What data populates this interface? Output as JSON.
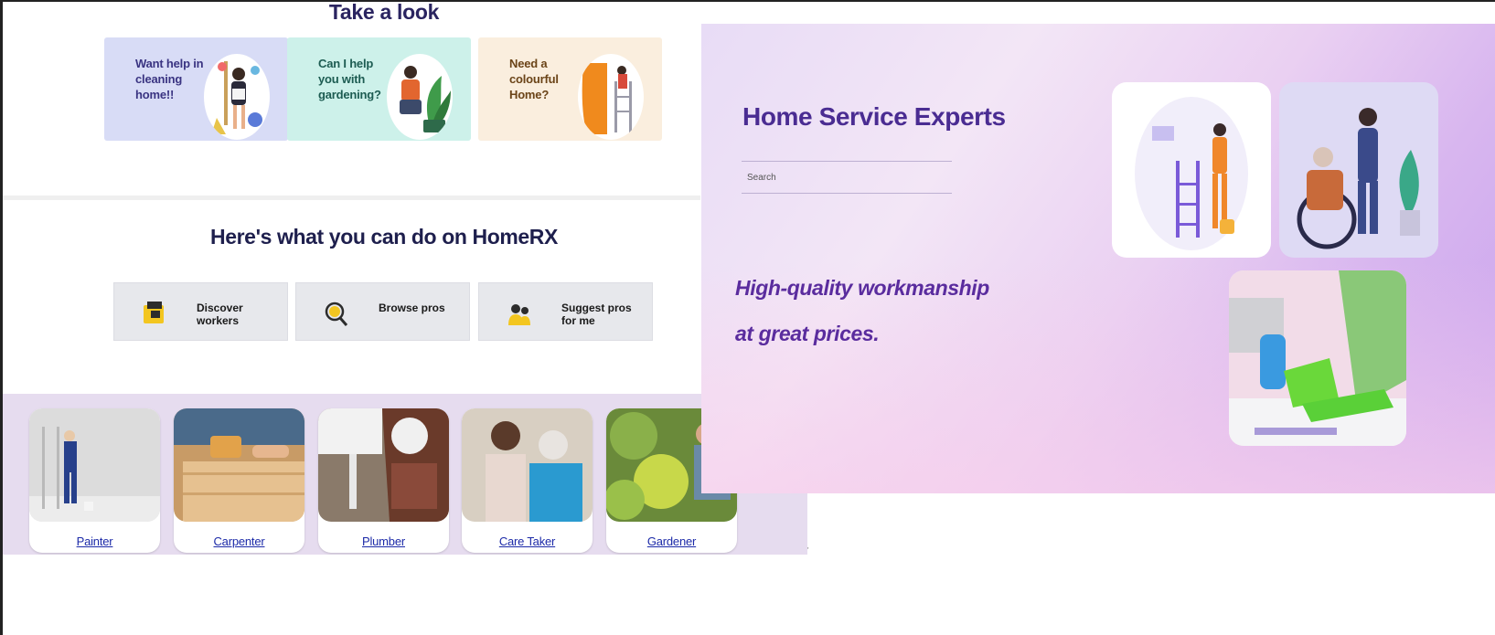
{
  "take_a_look": {
    "title": "Take a look",
    "cards": [
      {
        "label": "Want help in cleaning home!!"
      },
      {
        "label": "Can I help you with gardening?"
      },
      {
        "label": "Need a colourful Home?"
      }
    ]
  },
  "homerx": {
    "title": "Here's what you can do on HomeRX",
    "actions": [
      {
        "label": "Discover workers",
        "icon": "folder-icon"
      },
      {
        "label": "Browse pros",
        "icon": "magnifier-icon"
      },
      {
        "label": "Suggest pros for me",
        "icon": "people-icon"
      }
    ]
  },
  "workers": [
    {
      "label": "Painter"
    },
    {
      "label": "Carpenter"
    },
    {
      "label": "Plumber"
    },
    {
      "label": "Care Taker"
    },
    {
      "label": "Gardener"
    }
  ],
  "hero": {
    "title": "Home Service Experts",
    "search_placeholder": "Search",
    "tagline_line1": "High-quality workmanship",
    "tagline_line2": "at great prices."
  },
  "colors": {
    "hero_title": "#4a2c92",
    "tagline": "#5a2c9e",
    "link": "#1c2aa8",
    "heading": "#1e1f4d"
  }
}
